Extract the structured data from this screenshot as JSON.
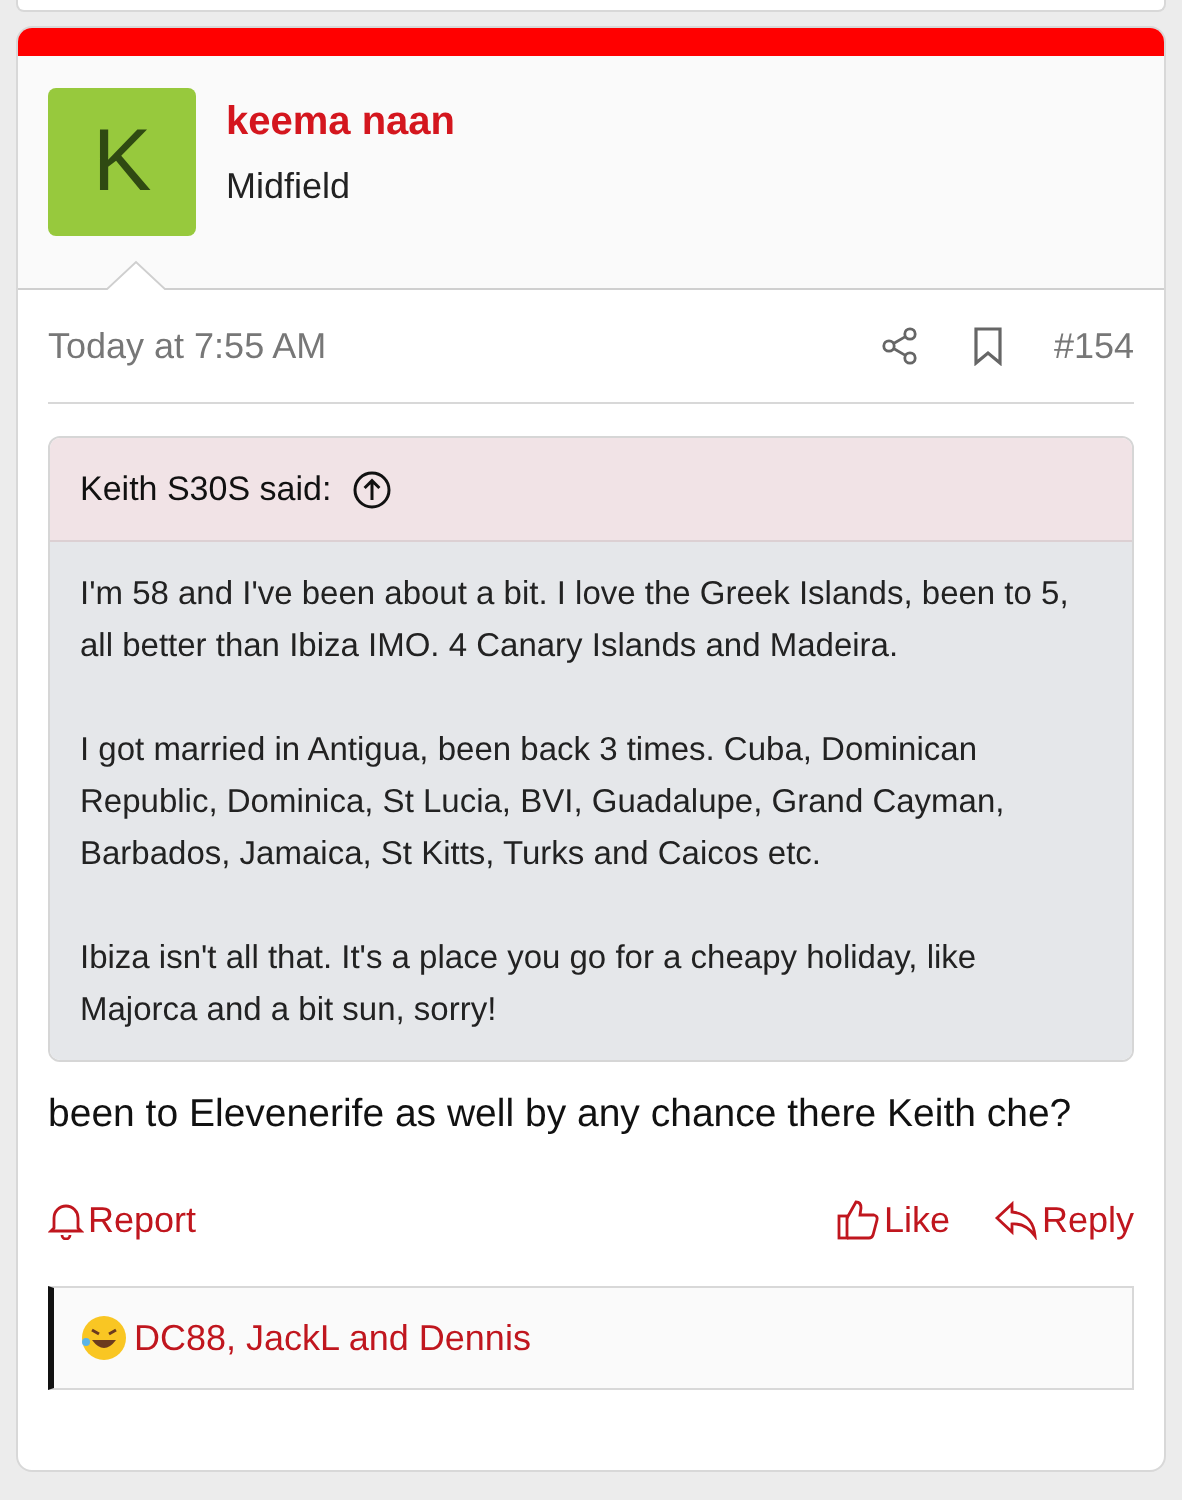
{
  "post": {
    "author": {
      "initial": "K",
      "name": "keema naan",
      "title": "Midfield"
    },
    "time": "Today at 7:55 AM",
    "number": "#154",
    "quote": {
      "author": "Keith S30S said:",
      "paragraphs": [
        "I'm 58 and I've been about a bit. I love the Greek Islands, been to 5, all better than Ibiza IMO. 4 Canary Islands and Madeira.",
        "I got married in Antigua, been back 3 times. Cuba, Dominican Republic, Dominica, St Lucia, BVI, Guadalupe, Grand Cayman, Barbados, Jamaica, St Kitts, Turks and Caicos etc.",
        "Ibiza isn't all that. It's a place you go for a cheapy holiday, like Majorca and a bit sun, sorry!"
      ]
    },
    "message": "been to Elevenerife as well by any chance there Keith che?",
    "actions": [
      {
        "label": "Report",
        "kind": "report"
      },
      {
        "label": "Like",
        "kind": "like"
      },
      {
        "label": "Reply",
        "kind": "reply"
      }
    ],
    "reactions": "DC88, JackL and Dennis"
  }
}
